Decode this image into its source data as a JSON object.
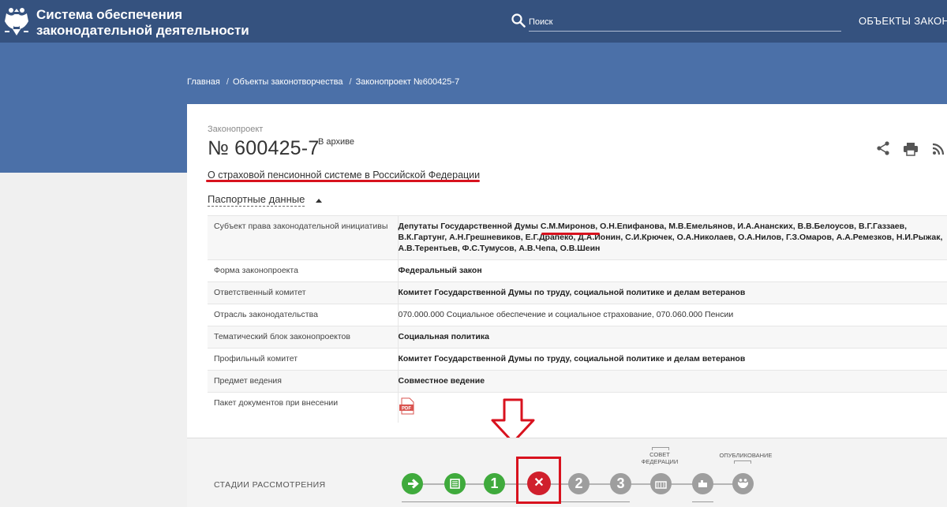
{
  "header": {
    "site_title_line1": "Система обеспечения",
    "site_title_line2": "законодательной деятельности",
    "search_placeholder": "Поиск",
    "nav_objects": "ОБЪЕКТЫ ЗАКОНО"
  },
  "breadcrumb": {
    "items": [
      "Главная",
      "Объекты законотворчества",
      "Законопроект №600425-7"
    ]
  },
  "bill": {
    "label": "Законопроект",
    "number": "№ 600425-7",
    "status_badge": "В архиве",
    "title": "О страховой пенсионной системе в Российской Федерации"
  },
  "passport": {
    "toggle_label": "Паспортные данные",
    "rows": [
      {
        "key": "Субъект права законодательной инициативы",
        "value": "Депутаты Государственной Думы С.М.Миронов, О.Н.Епифанова, М.В.Емельянов, И.А.Ананских, В.В.Белоусов, В.Г.Газзаев, В.К.Гартунг, А.Н.Грешневиков, Е.Г.Драпеко, Д.А.Ионин, С.И.Крючек, О.А.Николаев, О.А.Нилов, Г.З.Омаров, А.А.Ремезков, Н.И.Рыжак, А.В.Терентьев, Ф.С.Тумусов, А.В.Чепа, О.В.Шеин"
      },
      {
        "key": "Форма законопроекта",
        "value": "Федеральный закон"
      },
      {
        "key": "Ответственный комитет",
        "value": "Комитет Государственной Думы по труду, социальной политике и делам ветеранов"
      },
      {
        "key": "Отрасль законодательства",
        "value": "070.000.000 Социальное обеспечение и социальное страхование, 070.060.000 Пенсии"
      },
      {
        "key": "Тематический блок законопроектов",
        "value": "Социальная политика"
      },
      {
        "key": "Профильный комитет",
        "value": "Комитет Государственной Думы по труду, социальной политике и делам ветеранов"
      },
      {
        "key": "Предмет ведения",
        "value": "Совместное ведение"
      },
      {
        "key": "Пакет документов при внесении",
        "value": ""
      }
    ],
    "pdf_label": "PDF"
  },
  "stages": {
    "label": "СТАДИИ РАССМОТРЕНИЯ",
    "items": [
      {
        "kind": "arrow",
        "color": "#3faa3c"
      },
      {
        "kind": "doc",
        "color": "#3faa3c"
      },
      {
        "kind": "number",
        "text": "1",
        "color": "#3faa3c"
      },
      {
        "kind": "cross",
        "text": "✕",
        "color": "#d01f2c"
      },
      {
        "kind": "number",
        "text": "2",
        "color": "#9e9e9e"
      },
      {
        "kind": "number",
        "text": "3",
        "color": "#9e9e9e"
      },
      {
        "kind": "building",
        "color": "#9e9e9e"
      },
      {
        "kind": "sign",
        "color": "#9e9e9e"
      },
      {
        "kind": "emblem",
        "color": "#9e9e9e"
      }
    ],
    "caption_council": "СОВЕТ ФЕДЕРАЦИИ",
    "caption_published": "ОПУБЛИКОВАНИЕ"
  },
  "colors": {
    "topbar": "#35527f",
    "banner": "#4b70a8",
    "annotation_red": "#d8121e",
    "stage_done": "#3faa3c",
    "stage_rejected": "#d01f2c",
    "stage_pending": "#9e9e9e"
  }
}
